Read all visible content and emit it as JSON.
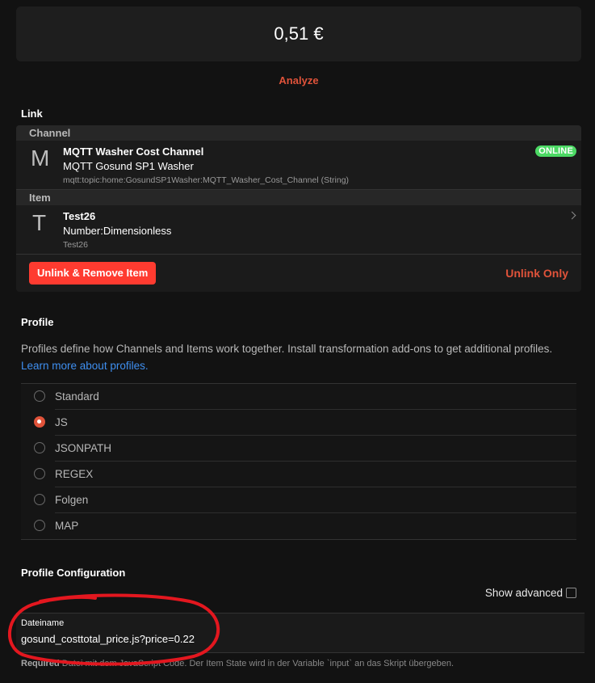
{
  "state": {
    "value": "0,51 €"
  },
  "analyze_label": "Analyze",
  "link": {
    "title": "Link",
    "channel": {
      "group_label": "Channel",
      "letter": "M",
      "title": "MQTT Washer Cost Channel",
      "subtitle": "MQTT Gosund SP1 Washer",
      "uid": "mqtt:topic:home:GosundSP1Washer:MQTT_Washer_Cost_Channel (String)",
      "status": "ONLINE",
      "status_color": "#4cd964"
    },
    "item": {
      "group_label": "Item",
      "letter": "T",
      "title": "Test26",
      "subtitle": "Number:Dimensionless",
      "name": "Test26"
    },
    "unlink_remove_label": "Unlink & Remove Item",
    "unlink_only_label": "Unlink Only"
  },
  "profile": {
    "title": "Profile",
    "description": "Profiles define how Channels and Items work together. Install transformation add-ons to get additional profiles.",
    "learn_more": "Learn more about profiles.",
    "options": [
      {
        "label": "Standard",
        "checked": false
      },
      {
        "label": "JS",
        "checked": true
      },
      {
        "label": "JSONPATH",
        "checked": false
      },
      {
        "label": "REGEX",
        "checked": false
      },
      {
        "label": "Folgen",
        "checked": false
      },
      {
        "label": "MAP",
        "checked": false
      }
    ]
  },
  "profile_config": {
    "title": "Profile Configuration",
    "show_advanced": "Show advanced",
    "field_label": "Dateiname",
    "field_value": "gosund_costtotal_price.js?price=0.22",
    "help_required": "Required",
    "help_text": "Datei mit dem JavaScript Code. Der Item State wird in der Variable `input` an das Skript übergeben."
  },
  "colors": {
    "accent": "#e0533a",
    "danger": "#ff3b30",
    "link": "#3f8ff0",
    "annotation": "#e3171f"
  }
}
